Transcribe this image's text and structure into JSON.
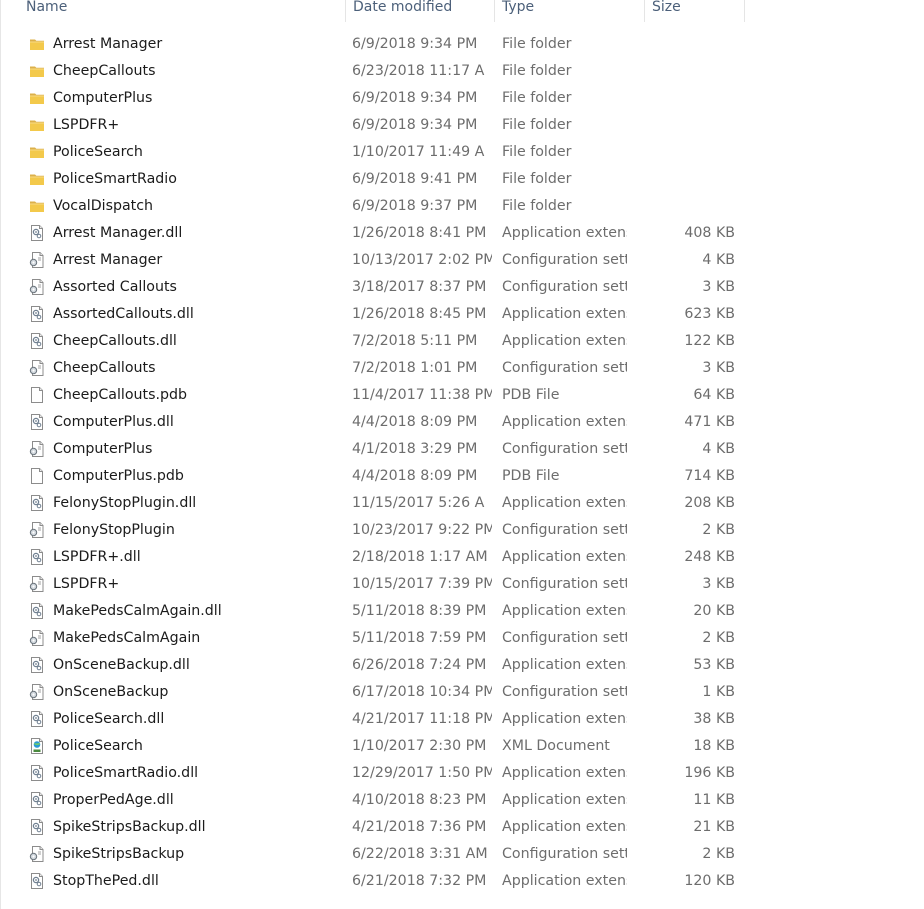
{
  "columns": {
    "name": "Name",
    "date": "Date modified",
    "type": "Type",
    "size": "Size"
  },
  "files": [
    {
      "icon": "folder-icon",
      "name": "Arrest Manager",
      "date": "6/9/2018 9:34 PM",
      "type": "File folder",
      "size": ""
    },
    {
      "icon": "folder-icon",
      "name": "CheepCallouts",
      "date": "6/23/2018 11:17 A",
      "type": "File folder",
      "size": ""
    },
    {
      "icon": "folder-icon",
      "name": "ComputerPlus",
      "date": "6/9/2018 9:34 PM",
      "type": "File folder",
      "size": ""
    },
    {
      "icon": "folder-icon",
      "name": "LSPDFR+",
      "date": "6/9/2018 9:34 PM",
      "type": "File folder",
      "size": ""
    },
    {
      "icon": "folder-icon",
      "name": "PoliceSearch",
      "date": "1/10/2017 11:49 A",
      "type": "File folder",
      "size": ""
    },
    {
      "icon": "folder-icon",
      "name": "PoliceSmartRadio",
      "date": "6/9/2018 9:41 PM",
      "type": "File folder",
      "size": ""
    },
    {
      "icon": "folder-icon",
      "name": "VocalDispatch",
      "date": "6/9/2018 9:37 PM",
      "type": "File folder",
      "size": ""
    },
    {
      "icon": "dll-icon",
      "name": "Arrest Manager.dll",
      "date": "1/26/2018 8:41 PM",
      "type": "Application extens",
      "size": "408 KB"
    },
    {
      "icon": "config-icon",
      "name": "Arrest Manager",
      "date": "10/13/2017 2:02 PM",
      "type": "Configuration setti",
      "size": "4 KB"
    },
    {
      "icon": "config-icon",
      "name": "Assorted Callouts",
      "date": "3/18/2017 8:37 PM",
      "type": "Configuration setti",
      "size": "3 KB"
    },
    {
      "icon": "dll-icon",
      "name": "AssortedCallouts.dll",
      "date": "1/26/2018 8:45 PM",
      "type": "Application extens",
      "size": "623 KB"
    },
    {
      "icon": "dll-icon",
      "name": "CheepCallouts.dll",
      "date": "7/2/2018 5:11 PM",
      "type": "Application extens",
      "size": "122 KB"
    },
    {
      "icon": "config-icon",
      "name": "CheepCallouts",
      "date": "7/2/2018 1:01 PM",
      "type": "Configuration setti",
      "size": "3 KB"
    },
    {
      "icon": "blank-file-icon",
      "name": "CheepCallouts.pdb",
      "date": "11/4/2017 11:38 PM",
      "type": "PDB File",
      "size": "64 KB"
    },
    {
      "icon": "dll-icon",
      "name": "ComputerPlus.dll",
      "date": "4/4/2018 8:09 PM",
      "type": "Application extens",
      "size": "471 KB"
    },
    {
      "icon": "config-icon",
      "name": "ComputerPlus",
      "date": "4/1/2018 3:29 PM",
      "type": "Configuration setti",
      "size": "4 KB"
    },
    {
      "icon": "blank-file-icon",
      "name": "ComputerPlus.pdb",
      "date": "4/4/2018 8:09 PM",
      "type": "PDB File",
      "size": "714 KB"
    },
    {
      "icon": "dll-icon",
      "name": "FelonyStopPlugin.dll",
      "date": "11/15/2017 5:26 A",
      "type": "Application extens",
      "size": "208 KB"
    },
    {
      "icon": "config-icon",
      "name": "FelonyStopPlugin",
      "date": "10/23/2017 9:22 PM",
      "type": "Configuration setti",
      "size": "2 KB"
    },
    {
      "icon": "dll-icon",
      "name": "LSPDFR+.dll",
      "date": "2/18/2018 1:17 AM",
      "type": "Application extens",
      "size": "248 KB"
    },
    {
      "icon": "config-icon",
      "name": "LSPDFR+",
      "date": "10/15/2017 7:39 PM",
      "type": "Configuration setti",
      "size": "3 KB"
    },
    {
      "icon": "dll-icon",
      "name": "MakePedsCalmAgain.dll",
      "date": "5/11/2018 8:39 PM",
      "type": "Application extens",
      "size": "20 KB"
    },
    {
      "icon": "config-icon",
      "name": "MakePedsCalmAgain",
      "date": "5/11/2018 7:59 PM",
      "type": "Configuration setti",
      "size": "2 KB"
    },
    {
      "icon": "dll-icon",
      "name": "OnSceneBackup.dll",
      "date": "6/26/2018 7:24 PM",
      "type": "Application extens",
      "size": "53 KB"
    },
    {
      "icon": "config-icon",
      "name": "OnSceneBackup",
      "date": "6/17/2018 10:34 PM",
      "type": "Configuration setti",
      "size": "1 KB"
    },
    {
      "icon": "dll-icon",
      "name": "PoliceSearch.dll",
      "date": "4/21/2017 11:18 PM",
      "type": "Application extens",
      "size": "38 KB"
    },
    {
      "icon": "xml-icon",
      "name": "PoliceSearch",
      "date": "1/10/2017 2:30 PM",
      "type": "XML Document",
      "size": "18 KB"
    },
    {
      "icon": "dll-icon",
      "name": "PoliceSmartRadio.dll",
      "date": "12/29/2017 1:50 PM",
      "type": "Application extens",
      "size": "196 KB"
    },
    {
      "icon": "dll-icon",
      "name": "ProperPedAge.dll",
      "date": "4/10/2018 8:23 PM",
      "type": "Application extens",
      "size": "11 KB"
    },
    {
      "icon": "dll-icon",
      "name": "SpikeStripsBackup.dll",
      "date": "4/21/2018 7:36 PM",
      "type": "Application extens",
      "size": "21 KB"
    },
    {
      "icon": "config-icon",
      "name": "SpikeStripsBackup",
      "date": "6/22/2018 3:31 AM",
      "type": "Configuration setti",
      "size": "2 KB"
    },
    {
      "icon": "dll-icon",
      "name": "StopThePed.dll",
      "date": "6/21/2018 7:32 PM",
      "type": "Application extens",
      "size": "120 KB"
    }
  ]
}
